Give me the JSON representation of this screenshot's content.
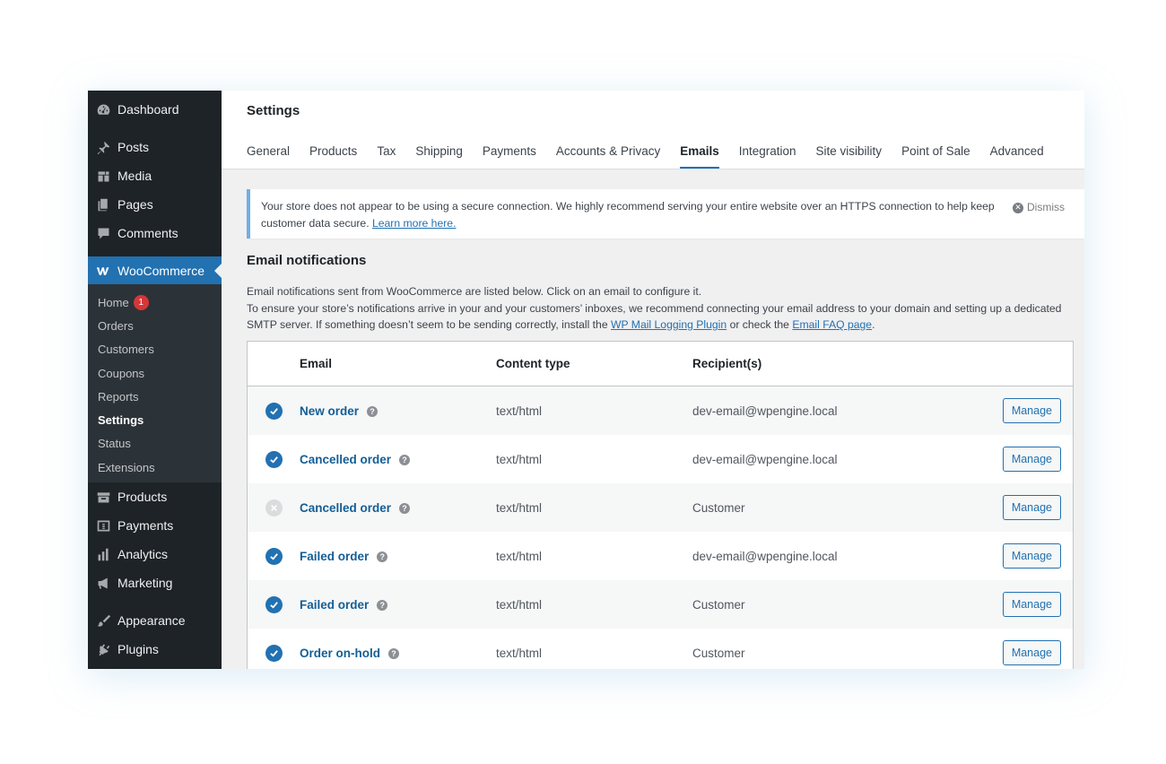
{
  "sidebar": {
    "items": [
      {
        "label": "Dashboard",
        "icon": "dashboard-icon"
      },
      {
        "label": "Posts",
        "icon": "pin-icon"
      },
      {
        "label": "Media",
        "icon": "media-icon"
      },
      {
        "label": "Pages",
        "icon": "pages-icon"
      },
      {
        "label": "Comments",
        "icon": "comments-icon"
      },
      {
        "label": "WooCommerce",
        "icon": "woocommerce-icon"
      },
      {
        "label": "Products",
        "icon": "archive-icon"
      },
      {
        "label": "Payments",
        "icon": "payments-icon"
      },
      {
        "label": "Analytics",
        "icon": "bar-chart-icon"
      },
      {
        "label": "Marketing",
        "icon": "megaphone-icon"
      },
      {
        "label": "Appearance",
        "icon": "paintbrush-icon"
      },
      {
        "label": "Plugins",
        "icon": "plugin-icon"
      }
    ],
    "woo_submenu": [
      {
        "label": "Home",
        "badge": "1"
      },
      {
        "label": "Orders"
      },
      {
        "label": "Customers"
      },
      {
        "label": "Coupons"
      },
      {
        "label": "Reports"
      },
      {
        "label": "Settings"
      },
      {
        "label": "Status"
      },
      {
        "label": "Extensions"
      }
    ]
  },
  "header": {
    "title": "Settings",
    "tabs": [
      "General",
      "Products",
      "Tax",
      "Shipping",
      "Payments",
      "Accounts & Privacy",
      "Emails",
      "Integration",
      "Site visibility",
      "Point of Sale",
      "Advanced"
    ],
    "active_tab": "Emails"
  },
  "notice": {
    "text": "Your store does not appear to be using a secure connection. We highly recommend serving your entire website over an HTTPS connection to help keep customer data secure.",
    "link": "Learn more here.",
    "dismiss": "Dismiss"
  },
  "section": {
    "title": "Email notifications",
    "intro_line1": "Email notifications sent from WooCommerce are listed below. Click on an email to configure it.",
    "intro_line2": "To ensure your store’s notifications arrive in your and your customers’ inboxes, we recommend connecting your email address to your domain and setting up a dedicated SMTP server. If something doesn’t seem to be sending correctly, install the",
    "intro_link1": "WP Mail Logging Plugin",
    "intro_mid": "or check the",
    "intro_link2": "Email FAQ page",
    "intro_end": "."
  },
  "table": {
    "headers": {
      "email": "Email",
      "content_type": "Content type",
      "recipients": "Recipient(s)"
    },
    "rows": [
      {
        "enabled": true,
        "email": "New order",
        "content_type": "text/html",
        "recipients": "dev-email@wpengine.local",
        "action": "Manage"
      },
      {
        "enabled": true,
        "email": "Cancelled order",
        "content_type": "text/html",
        "recipients": "dev-email@wpengine.local",
        "action": "Manage"
      },
      {
        "enabled": false,
        "email": "Cancelled order",
        "content_type": "text/html",
        "recipients": "Customer",
        "action": "Manage"
      },
      {
        "enabled": true,
        "email": "Failed order",
        "content_type": "text/html",
        "recipients": "dev-email@wpengine.local",
        "action": "Manage"
      },
      {
        "enabled": true,
        "email": "Failed order",
        "content_type": "text/html",
        "recipients": "Customer",
        "action": "Manage"
      },
      {
        "enabled": true,
        "email": "Order on-hold",
        "content_type": "text/html",
        "recipients": "Customer",
        "action": "Manage"
      }
    ]
  },
  "colors": {
    "admin_bar": "#1d2327",
    "accent": "#2271b1",
    "submenu": "#2c3338",
    "badge": "#d63638"
  }
}
